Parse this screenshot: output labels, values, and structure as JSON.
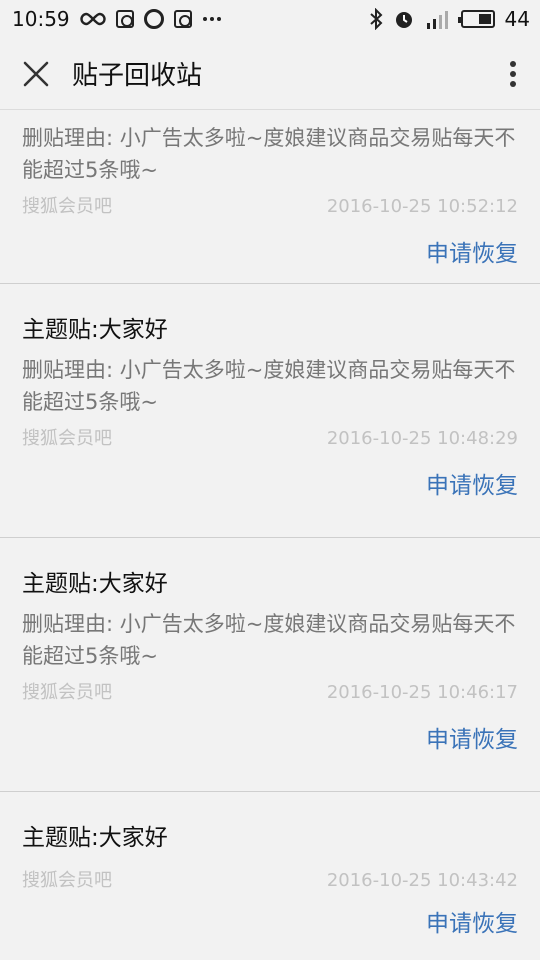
{
  "status_bar": {
    "time": "10:59",
    "battery": "44",
    "battery_level": 0.44,
    "icons": [
      "infinity-icon",
      "notification-icon",
      "sync-icon",
      "notification-icon",
      "more-dots-icon",
      "bluetooth-icon",
      "alarm-icon",
      "signal-icon",
      "battery-icon"
    ]
  },
  "app_bar": {
    "title": "贴子回收站",
    "close_icon": "close-icon",
    "more_icon": "more-vertical-icon"
  },
  "posts": [
    {
      "title": "",
      "reason": "删贴理由: 小广告太多啦~度娘建议商品交易贴每天不能超过5条哦~",
      "forum": "搜狐会员吧",
      "time": "2016-10-25 10:52:12",
      "action": "申请恢复"
    },
    {
      "title": "主题贴:大家好",
      "reason": "删贴理由: 小广告太多啦~度娘建议商品交易贴每天不能超过5条哦~",
      "forum": "搜狐会员吧",
      "time": "2016-10-25 10:48:29",
      "action": "申请恢复"
    },
    {
      "title": "主题贴:大家好",
      "reason": "删贴理由: 小广告太多啦~度娘建议商品交易贴每天不能超过5条哦~",
      "forum": "搜狐会员吧",
      "time": "2016-10-25 10:46:17",
      "action": "申请恢复"
    },
    {
      "title": "主题贴:大家好",
      "reason": "",
      "forum": "搜狐会员吧",
      "time": "2016-10-25 10:43:42",
      "action": "申请恢复"
    }
  ],
  "colors": {
    "background": "#f2f2f2",
    "action_blue": "#3a73b8",
    "meta_gray": "#c2c2c2",
    "reason_gray": "#777777"
  }
}
